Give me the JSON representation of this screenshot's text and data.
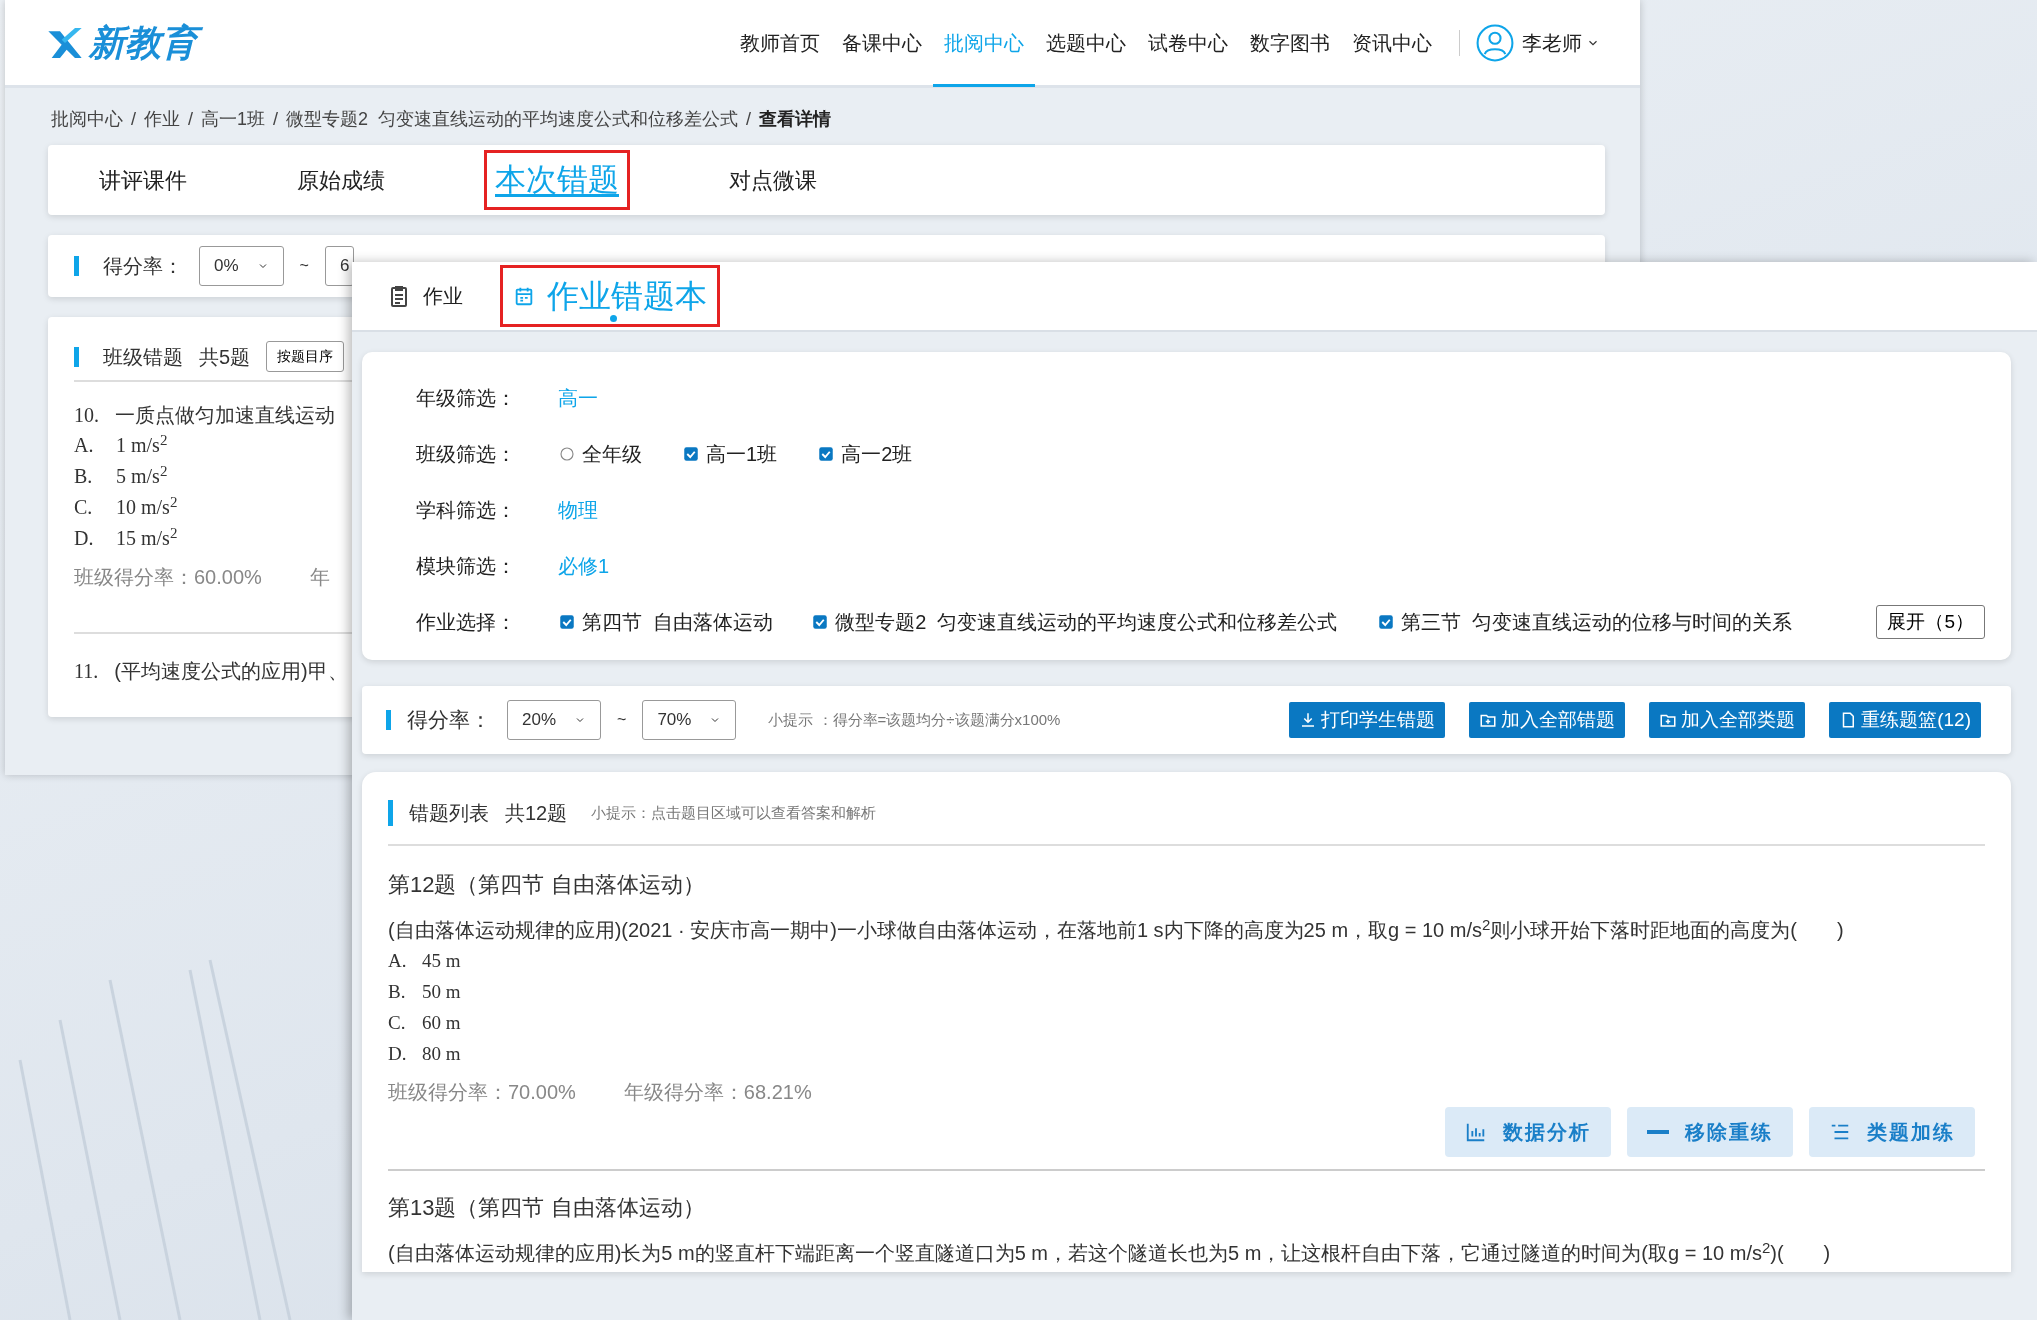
{
  "back_window": {
    "logo": {
      "text": "新教育"
    },
    "nav": [
      {
        "label": "教师首页",
        "selected": false
      },
      {
        "label": "备课中心",
        "selected": false
      },
      {
        "label": "批阅中心",
        "selected": true
      },
      {
        "label": "选题中心",
        "selected": false
      },
      {
        "label": "试卷中心",
        "selected": false
      },
      {
        "label": "数字图书",
        "selected": false
      },
      {
        "label": "资讯中心",
        "selected": false
      }
    ],
    "user": {
      "name": "李老师"
    },
    "breadcrumb": {
      "separator": "/",
      "items": [
        "批阅中心",
        "作业",
        "高一1班",
        "微型专题2  匀变速直线运动的平均速度公式和位移差公式",
        "查看详情"
      ]
    },
    "tabs": [
      {
        "label": "讲评课件",
        "selected": false,
        "highlighted": false
      },
      {
        "label": "原始成绩",
        "selected": false,
        "highlighted": false
      },
      {
        "label": "本次错题",
        "selected": true,
        "highlighted": true
      },
      {
        "label": "对点微课",
        "selected": false,
        "highlighted": false
      }
    ],
    "score_filter": {
      "label": "得分率：",
      "from": "0%",
      "tilde": "~",
      "to": "6"
    },
    "list": {
      "title": "班级错题",
      "count": "共5题",
      "sort_button": "按题目序"
    },
    "questions": [
      {
        "number": "10.",
        "text": "一质点做匀加速直线运动",
        "options": [
          {
            "letter": "A.",
            "text": "1 m/s$^{2}$"
          },
          {
            "letter": "B.",
            "text": "5 m/s$^{2}$"
          },
          {
            "letter": "C.",
            "text": "10 m/s$^{2}$"
          },
          {
            "letter": "D.",
            "text": "15 m/s$^{2}$"
          }
        ],
        "class_rate": "班级得分率：60.00%",
        "grade_rate": "年"
      },
      {
        "number": "11.",
        "text": "(平均速度公式的应用)甲、"
      }
    ]
  },
  "front_window": {
    "tabs": [
      {
        "label": "作业",
        "selected": false,
        "highlighted": false
      },
      {
        "label": "作业错题本",
        "selected": true,
        "highlighted": true
      }
    ],
    "filters": [
      {
        "label": "年级筛选：",
        "kind": "links",
        "options": [
          {
            "label": "高一"
          }
        ]
      },
      {
        "label": "班级筛选：",
        "kind": "checks",
        "options": [
          {
            "label": "全年级",
            "kind": "radio",
            "checked": false
          },
          {
            "label": "高一1班",
            "kind": "checkbox",
            "checked": true
          },
          {
            "label": "高一2班",
            "kind": "checkbox",
            "checked": true
          }
        ]
      },
      {
        "label": "学科筛选：",
        "kind": "links",
        "options": [
          {
            "label": "物理"
          }
        ]
      },
      {
        "label": "模块筛选：",
        "kind": "links",
        "options": [
          {
            "label": "必修1"
          }
        ]
      },
      {
        "label": "作业选择：",
        "kind": "checks",
        "expand": "展开（5）",
        "options": [
          {
            "label": "第四节  自由落体运动",
            "kind": "checkbox",
            "checked": true
          },
          {
            "label": "微型专题2  匀变速直线运动的平均速度公式和位移差公式",
            "kind": "checkbox",
            "checked": true
          },
          {
            "label": "第三节  匀变速直线运动的位移与时间的关系",
            "kind": "checkbox",
            "checked": true
          }
        ]
      }
    ],
    "score_filter": {
      "label": "得分率：",
      "from": "20%",
      "tilde": "~",
      "to": "70%",
      "hint": "小提示 ：得分率=该题均分÷该题满分x100%",
      "buttons": [
        {
          "label": "打印学生错题"
        },
        {
          "label": "加入全部错题"
        },
        {
          "label": "加入全部类题"
        },
        {
          "label": "重练题篮(12)"
        }
      ]
    },
    "list": {
      "title": "错题列表",
      "count": "共12题",
      "hint": "小提示：点击题目区域可以查看答案和解析"
    },
    "questions": [
      {
        "heading": "第12题（第四节 自由落体运动）",
        "text": "(自由落体运动规律的应用)(2021 · 安庆市高一期中)一小球做自由落体运动，在落地前1 s内下降的高度为25 m，取g = 10 m/s$^{2}$则小球开始下落时距地面的高度为(　　)",
        "options": [
          {
            "letter": "A.",
            "text": "45 m"
          },
          {
            "letter": "B.",
            "text": "50 m"
          },
          {
            "letter": "C.",
            "text": "60 m"
          },
          {
            "letter": "D.",
            "text": "80 m"
          }
        ],
        "class_rate": "班级得分率：70.00%",
        "grade_rate": "年级得分率：68.21%",
        "actions": [
          {
            "label": "数据分析"
          },
          {
            "label": "移除重练"
          },
          {
            "label": "类题加练"
          }
        ]
      },
      {
        "heading": "第13题（第四节 自由落体运动）",
        "text": "(自由落体运动规律的应用)长为5 m的竖直杆下端距离一个竖直隧道口为5 m，若这个隧道长也为5 m，让这根杆自由下落，它通过隧道的时间为(取g = 10 m/s$^{2}$)(　　)"
      }
    ]
  }
}
